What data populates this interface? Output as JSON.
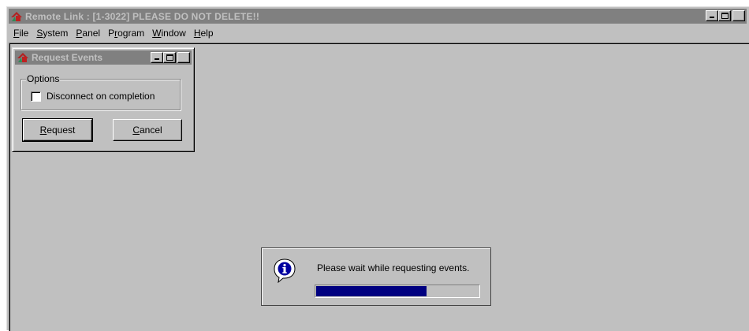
{
  "app": {
    "title": "Remote Link : [1-3022] PLEASE DO NOT DELETE!!",
    "close_glyph": "✕"
  },
  "menu": {
    "items": [
      {
        "accel": "F",
        "rest": "ile"
      },
      {
        "accel": "S",
        "rest": "ystem"
      },
      {
        "accel": "P",
        "rest": "anel"
      },
      {
        "pre": "P",
        "accel": "r",
        "rest": "ogram"
      },
      {
        "accel": "W",
        "rest": "indow"
      },
      {
        "accel": "H",
        "rest": "elp"
      }
    ]
  },
  "request_events": {
    "title": "Request Events",
    "group_label": "Options",
    "checkbox_label": "Disconnect on completion",
    "checkbox_checked": false,
    "request_button": {
      "accel": "R",
      "rest": "equest"
    },
    "cancel_button": {
      "accel": "C",
      "rest": "ancel"
    }
  },
  "progress": {
    "message": "Please wait while requesting events.",
    "fraction": 0.68,
    "bar_color": "#000080",
    "icon": "info-icon"
  }
}
